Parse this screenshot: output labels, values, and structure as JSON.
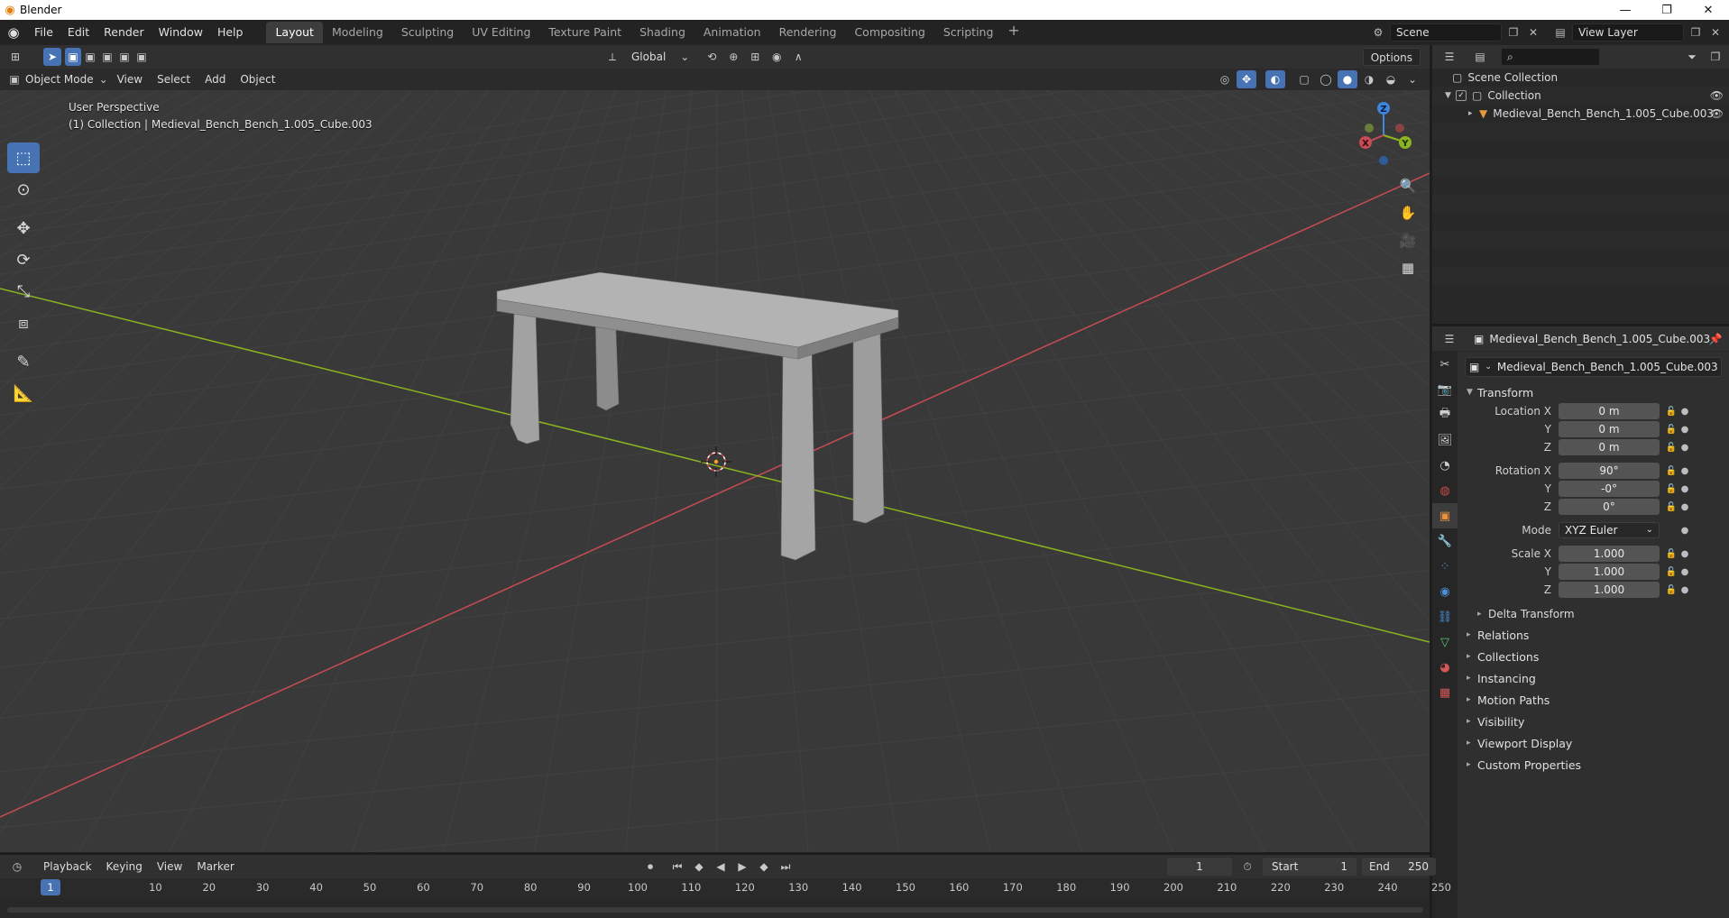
{
  "window": {
    "title": "Blender",
    "minimize": "—",
    "maximize": "❐",
    "close": "✕"
  },
  "menu": [
    "File",
    "Edit",
    "Render",
    "Window",
    "Help"
  ],
  "workspaces": [
    "Layout",
    "Modeling",
    "Sculpting",
    "UV Editing",
    "Texture Paint",
    "Shading",
    "Animation",
    "Rendering",
    "Compositing",
    "Scripting"
  ],
  "workspace_add": "+",
  "scene": {
    "name": "Scene",
    "view_layer": "View Layer"
  },
  "viewport": {
    "transform_orientation": "Global",
    "options_label": "Options",
    "mode": "Object Mode",
    "menus": [
      "View",
      "Select",
      "Add",
      "Object"
    ],
    "overlay_title": "User Perspective",
    "overlay_subtitle": "(1) Collection | Medieval_Bench_Bench_1.005_Cube.003"
  },
  "gizmo": {
    "z": "Z",
    "y": "Y",
    "x": "X"
  },
  "outliner": {
    "root": "Scene Collection",
    "collection": "Collection",
    "object": "Medieval_Bench_Bench_1.005_Cube.003"
  },
  "properties": {
    "header_name": "Medieval_Bench_Bench_1.005_Cube.003",
    "object_name": "Medieval_Bench_Bench_1.005_Cube.003",
    "transform_title": "Transform",
    "location": {
      "label": "Location X",
      "x": "0 m",
      "y": "0 m",
      "z": "0 m"
    },
    "rotation": {
      "label": "Rotation X",
      "x": "90°",
      "y": "-0°",
      "z": "0°"
    },
    "mode": {
      "label": "Mode",
      "value": "XYZ Euler"
    },
    "scale": {
      "label": "Scale X",
      "x": "1.000",
      "y": "1.000",
      "z": "1.000"
    },
    "axis_y": "Y",
    "axis_z": "Z",
    "delta_transform": "Delta Transform",
    "panels": [
      "Relations",
      "Collections",
      "Instancing",
      "Motion Paths",
      "Visibility",
      "Viewport Display",
      "Custom Properties"
    ]
  },
  "timeline": {
    "menus": [
      "Playback",
      "Keying",
      "View",
      "Marker"
    ],
    "current_frame": "1",
    "start_label": "Start",
    "start_value": "1",
    "end_label": "End",
    "end_value": "250",
    "ruler": [
      "10",
      "20",
      "30",
      "40",
      "50",
      "60",
      "70",
      "80",
      "90",
      "100",
      "110",
      "120",
      "130",
      "140",
      "150",
      "160",
      "170",
      "180",
      "190",
      "200",
      "210",
      "220",
      "230",
      "240",
      "250"
    ],
    "ruler_current": "1"
  },
  "colors": {
    "accent": "#4772b3",
    "x_axis": "#c94b55",
    "y_axis": "#8ab51f",
    "z_axis": "#3f85e0",
    "viewport_bg": "#393939"
  }
}
